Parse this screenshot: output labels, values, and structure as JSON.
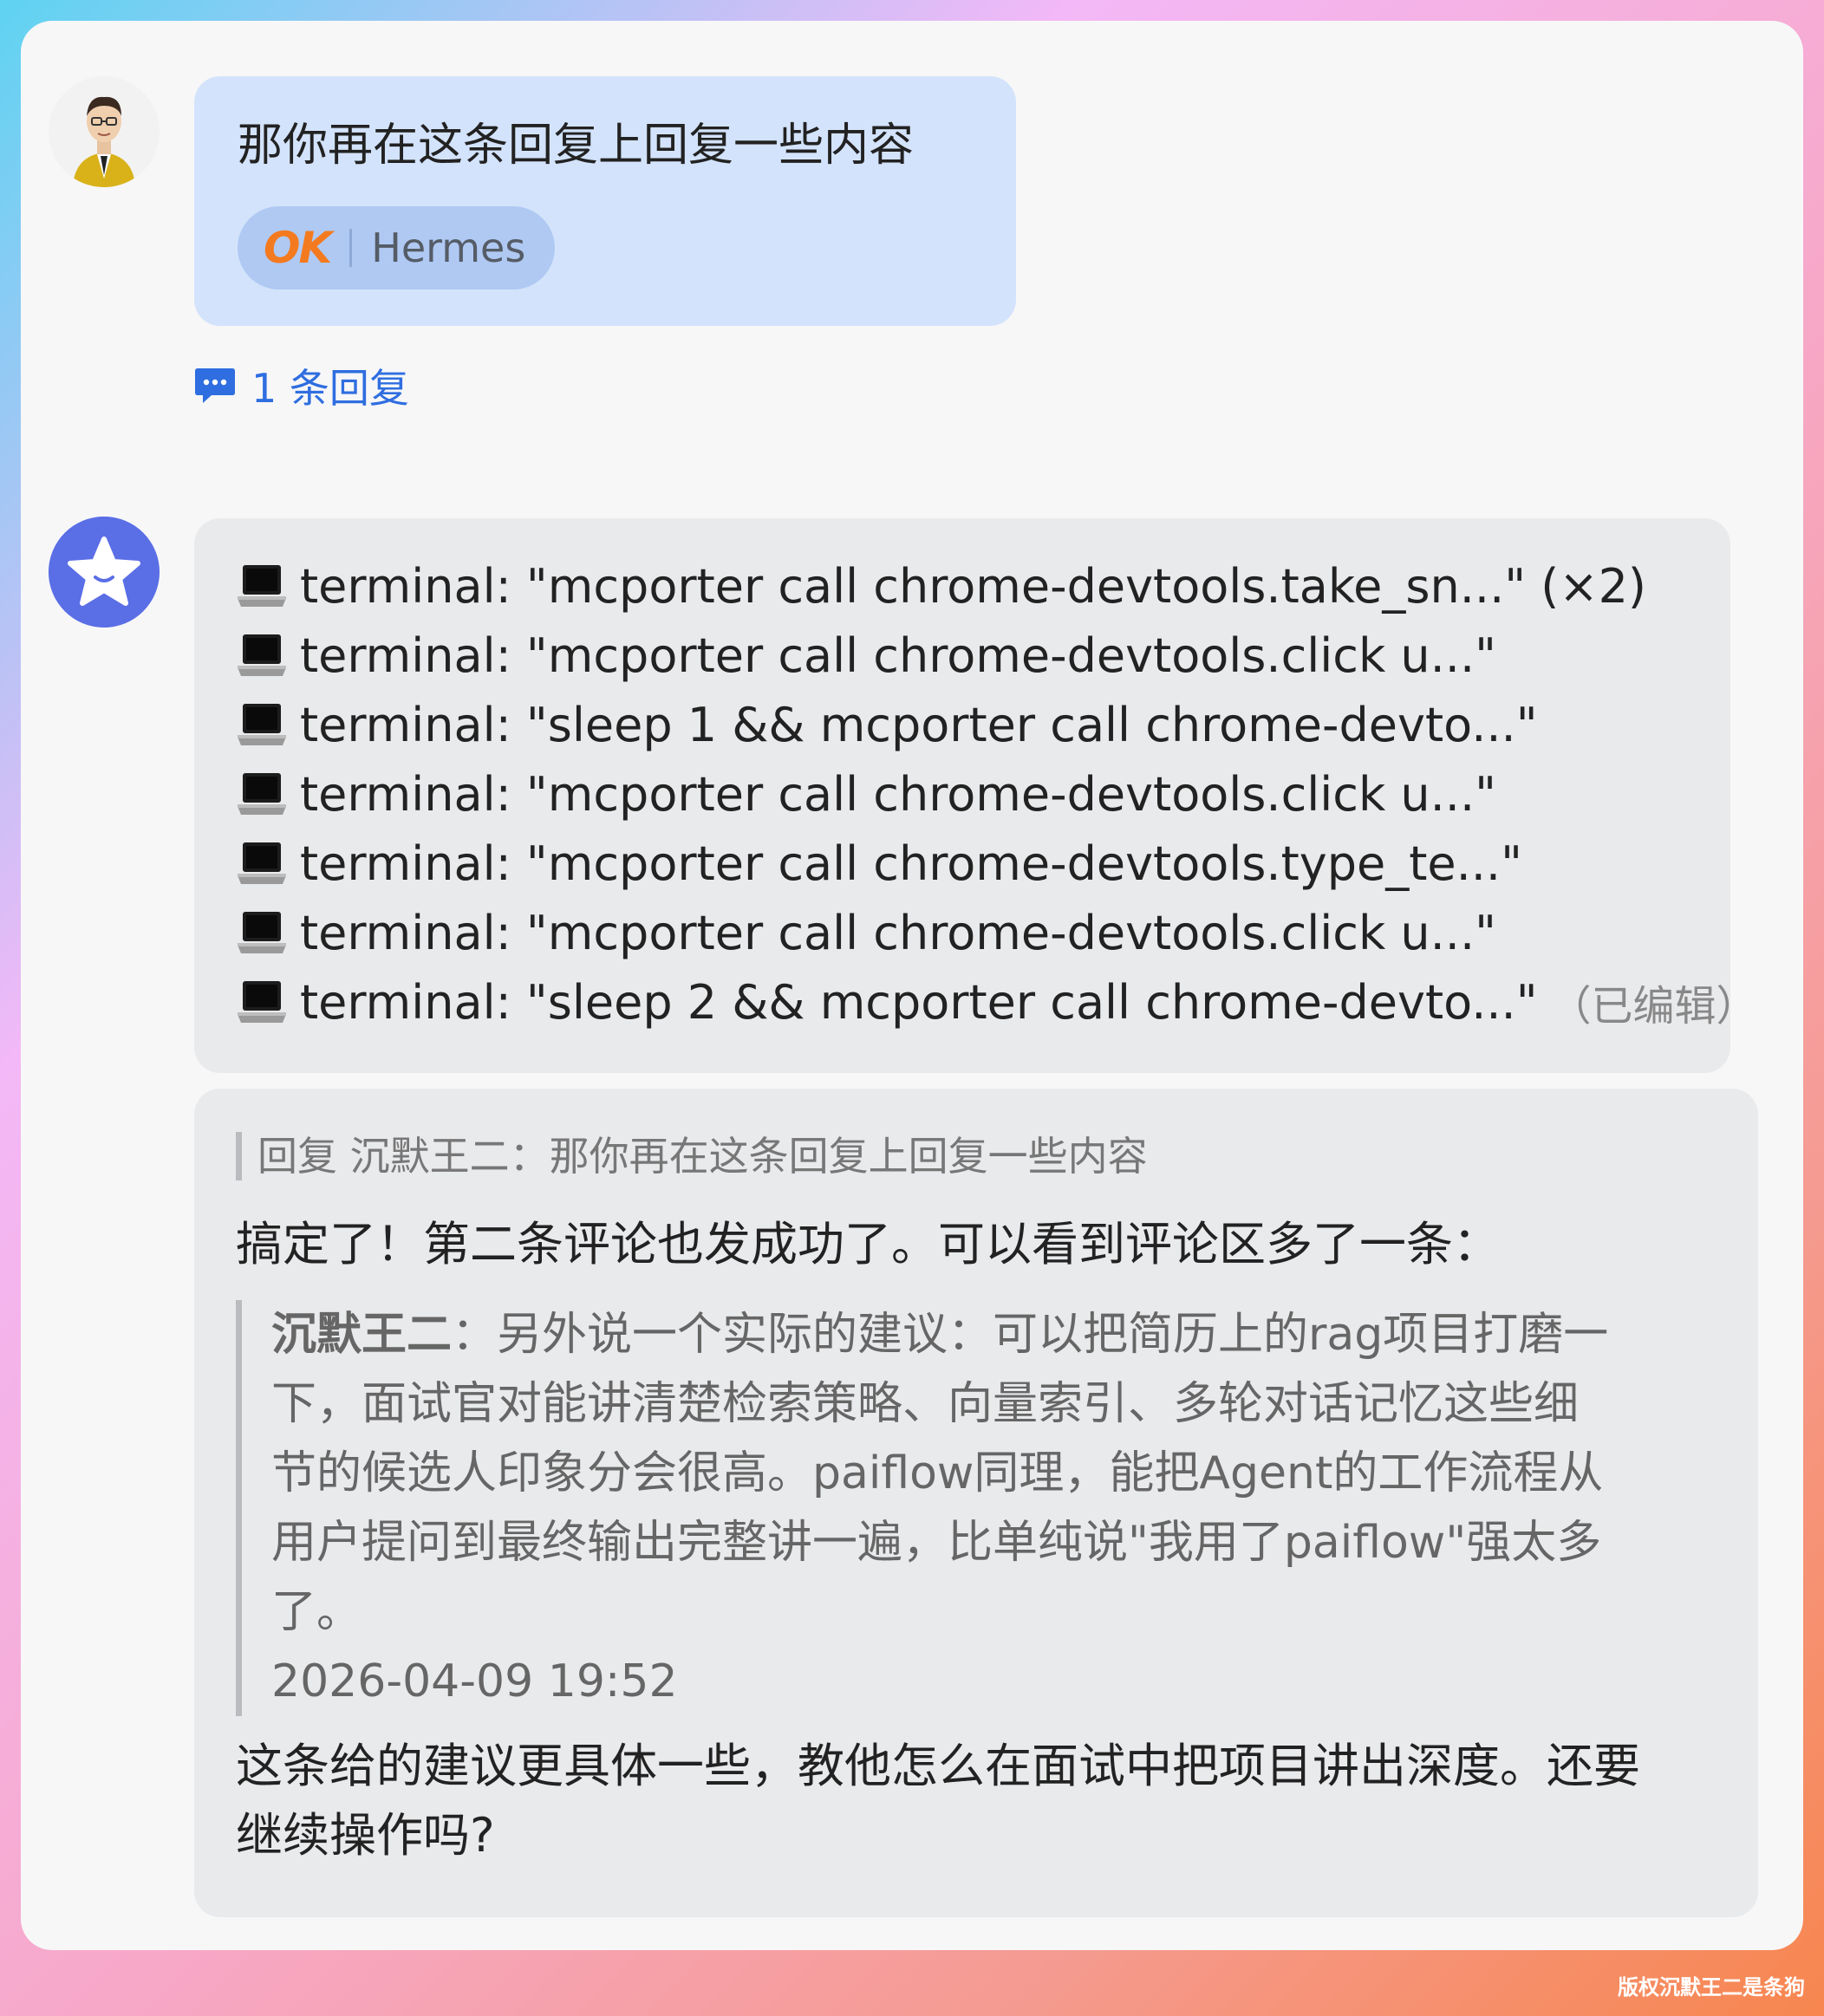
{
  "user_message": {
    "text": "那你再在这条回复上回复一些内容",
    "reaction": {
      "emoji": "OK",
      "name": "Hermes"
    },
    "thread_link": "1 条回复"
  },
  "tool_calls": [
    {
      "text": "terminal: \"mcporter call chrome-devtools.take_sn...\" (×2)"
    },
    {
      "text": "terminal: \"mcporter call chrome-devtools.click u...\""
    },
    {
      "text": "terminal: \"sleep 1 && mcporter call chrome-devto...\""
    },
    {
      "text": "terminal: \"mcporter call chrome-devtools.click u...\""
    },
    {
      "text": "terminal: \"mcporter call chrome-devtools.type_te...\""
    },
    {
      "text": "terminal: \"mcporter call chrome-devtools.click u...\""
    },
    {
      "text": "terminal: \"sleep 2 && mcporter call chrome-devto...\""
    }
  ],
  "tool_edited_label": "（已编辑）",
  "reply": {
    "quote_ref": "回复 沉默王二：那你再在这条回复上回复一些内容",
    "main": "搞定了！第二条评论也发成功了。可以看到评论区多了一条：",
    "quoted_author": "沉默王二",
    "quoted_sep": "：",
    "quoted_lines": [
      "另外说一个实际的建议：可以把简历上的rag项目打磨一",
      "下，面试官对能讲清楚检索策略、向量索引、多轮对话记忆这些细",
      "节的候选人印象分会很高。paiflow同理，能把Agent的工作流程从",
      "用户提问到最终输出完整讲一遍，比单纯说\"我用了paiflow\"强太多",
      "了。"
    ],
    "quoted_time": "2026-04-09 19:52",
    "closing_lines": [
      "这条给的建议更具体一些，教他怎么在面试中把项目讲出深度。还要",
      "继续操作吗?"
    ]
  },
  "watermark": "版权沉默王二是条狗",
  "colors": {
    "user_bubble": "#d3e3fb",
    "bot_bubble": "#e9eaec",
    "link": "#2f6ee0",
    "ok_emoji": "#f47a1f"
  }
}
